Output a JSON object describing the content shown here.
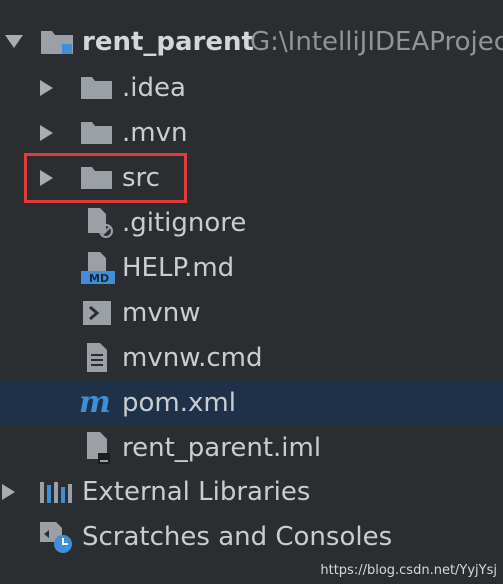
{
  "tree": {
    "root": {
      "name": "rent_parent",
      "path": "G:\\IntelliJIDEAProjec"
    },
    "items": [
      {
        "name": ".idea"
      },
      {
        "name": ".mvn"
      },
      {
        "name": "src"
      },
      {
        "name": ".gitignore"
      },
      {
        "name": "HELP.md"
      },
      {
        "name": "mvnw"
      },
      {
        "name": "mvnw.cmd"
      },
      {
        "name": "pom.xml"
      },
      {
        "name": "rent_parent.iml"
      }
    ],
    "external_libraries": "External Libraries",
    "scratches": "Scratches and Consoles"
  },
  "icons": {
    "folder": "folder-icon",
    "module": "module-folder-icon",
    "gitignore": "ignore-file-icon",
    "markdown": "markdown-file-icon",
    "shell": "shell-script-icon",
    "text": "text-file-icon",
    "maven": "maven-m-icon",
    "iml": "iml-file-icon",
    "libraries": "libraries-icon",
    "scratches": "scratches-icon"
  },
  "watermark": "https://blog.csdn.net/YyjYsj",
  "colors": {
    "background": "#2b2e31",
    "selection": "#1e3148",
    "highlight_box": "#e23b3b",
    "folder_gray": "#9aa0a6",
    "maven_blue": "#3f8fd8"
  }
}
